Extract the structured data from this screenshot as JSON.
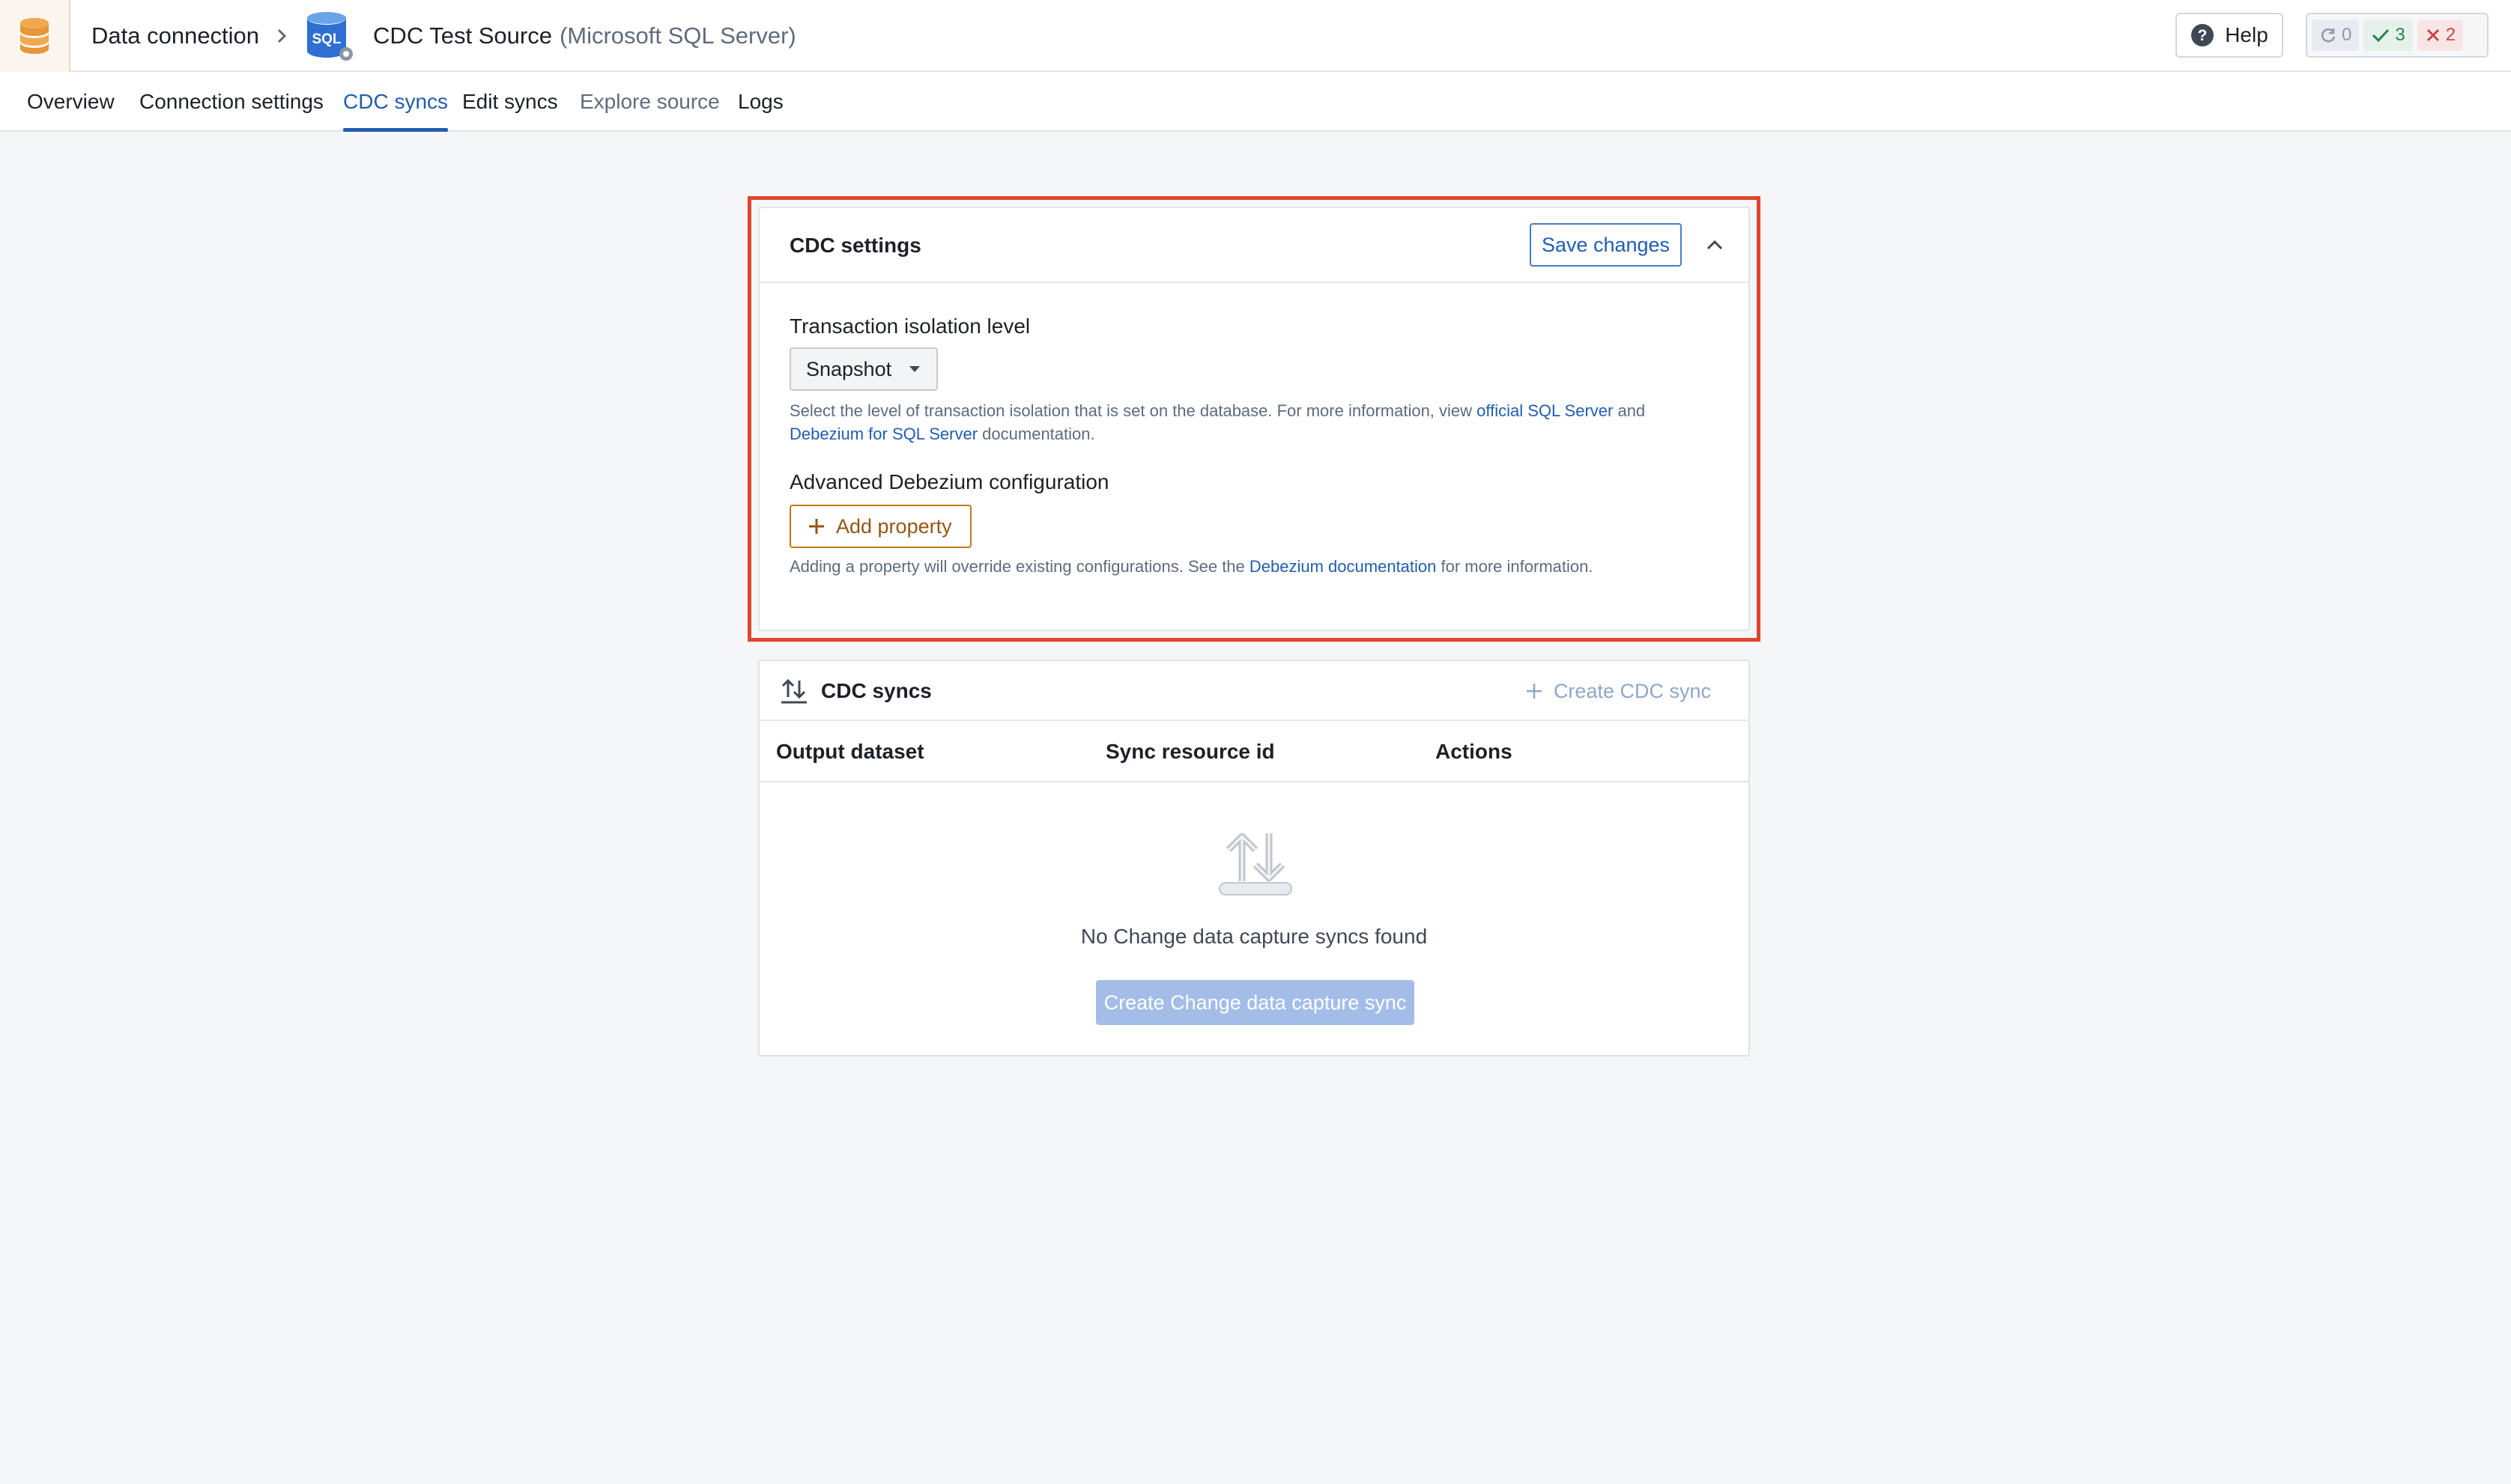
{
  "header": {
    "app_icon": "database-icon",
    "breadcrumb_root": "Data connection",
    "source_icon": "sql-server-icon",
    "source_icon_text": "SQL",
    "source_name": "CDC Test Source",
    "source_type": "(Microsoft SQL Server)",
    "help_label": "Help",
    "status": {
      "pending_count": "0",
      "success_count": "3",
      "failed_count": "2"
    }
  },
  "tabs": [
    {
      "label": "Overview",
      "state": "normal"
    },
    {
      "label": "Connection settings",
      "state": "normal"
    },
    {
      "label": "CDC syncs",
      "state": "active"
    },
    {
      "label": "Edit syncs",
      "state": "normal"
    },
    {
      "label": "Explore source",
      "state": "muted"
    },
    {
      "label": "Logs",
      "state": "normal"
    }
  ],
  "cdc_settings": {
    "title": "CDC settings",
    "save_label": "Save changes",
    "isolation_label": "Transaction isolation level",
    "isolation_value": "Snapshot",
    "isolation_help_prefix": "Select the level of transaction isolation that is set on the database. For more information, view ",
    "isolation_help_link1": "official SQL Server",
    "isolation_help_mid": " and ",
    "isolation_help_link2": "Debezium for SQL Server",
    "isolation_help_suffix": " documentation.",
    "advanced_label": "Advanced Debezium configuration",
    "add_property_label": "Add property",
    "advanced_help_prefix": "Adding a property will override existing configurations. See the ",
    "advanced_help_link": "Debezium documentation",
    "advanced_help_suffix": " for more information."
  },
  "cdc_syncs": {
    "title": "CDC syncs",
    "create_label": "Create CDC sync",
    "columns": [
      "Output dataset",
      "Sync resource id",
      "Actions"
    ],
    "empty_text": "No Change data capture syncs found",
    "empty_button": "Create Change data capture sync"
  },
  "colors": {
    "accent": "#215db0",
    "highlight": "#e0452f",
    "warning": "#c87619",
    "success": "#238551",
    "danger": "#cd4246"
  }
}
